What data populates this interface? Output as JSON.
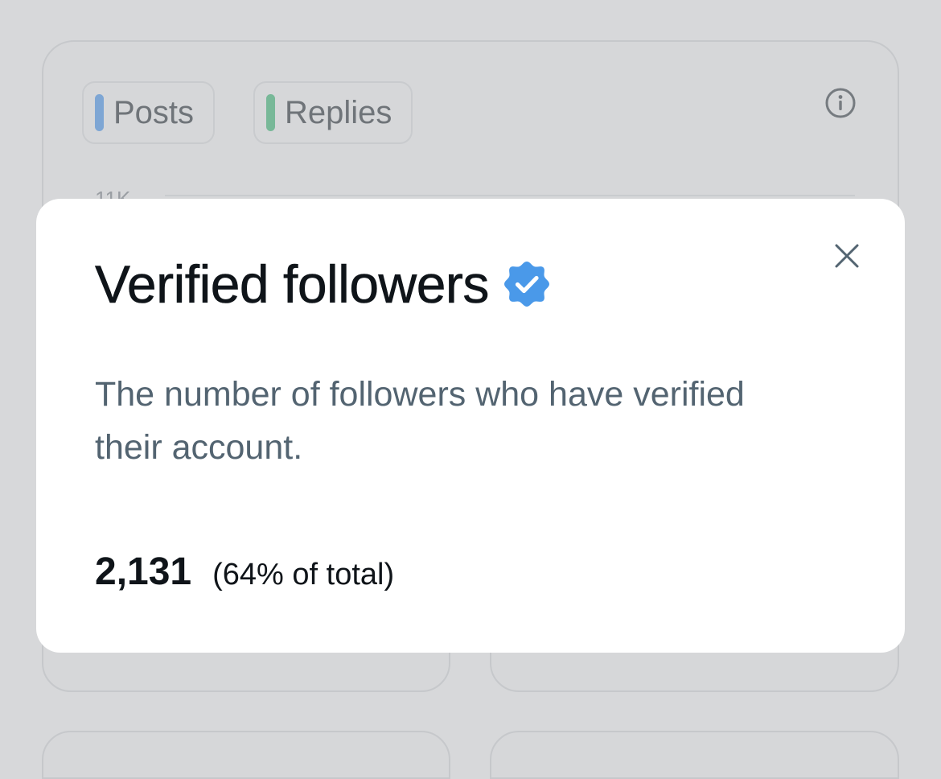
{
  "background": {
    "legend": [
      {
        "label": "Posts",
        "color": "#7ea6d4"
      },
      {
        "label": "Replies",
        "color": "#78b898"
      }
    ],
    "axis_fragment": "11K",
    "info_icon": "info-icon"
  },
  "modal": {
    "title": "Verified followers",
    "title_icon": "verified-badge-icon",
    "description": "The number of followers who have verified their account.",
    "metric_value": "2,131",
    "metric_share": "(64% of total)",
    "close_icon": "close-icon",
    "accent_color": "#4a99e9"
  }
}
